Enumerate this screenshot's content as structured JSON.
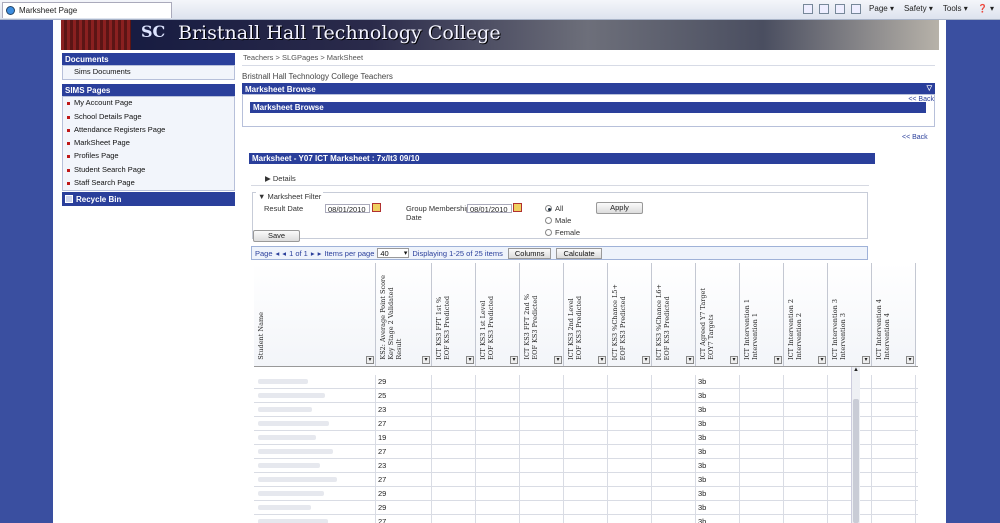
{
  "browser": {
    "tab_title": "Marksheet Page",
    "menus": [
      "Page ▾",
      "Safety ▾",
      "Tools ▾",
      "❓ ▾"
    ]
  },
  "banner": {
    "title": "Bristnall Hall Technology College",
    "logo_text": "SC"
  },
  "sidebar": {
    "documents_head": "Documents",
    "documents_items": [
      {
        "label": "Sims Documents"
      }
    ],
    "sims_head": "SIMS Pages",
    "sims_items": [
      {
        "label": "My Account Page"
      },
      {
        "label": "School Details Page"
      },
      {
        "label": "Attendance Registers Page"
      },
      {
        "label": "MarkSheet Page"
      },
      {
        "label": "Profiles Page"
      },
      {
        "label": "Student Search Page"
      },
      {
        "label": "Staff Search Page"
      }
    ],
    "recycle": "Recycle Bin"
  },
  "main": {
    "breadcrumb": "Teachers > SLGPages > MarkSheet",
    "subtitle": "Bristnall Hall Technology College Teachers",
    "browse_panel": "Marksheet Browse",
    "browse_title": "Marksheet Browse",
    "back_label": "<< Back",
    "marksheet_title": "Marksheet - Y07 ICT Marksheet : 7x/It3 09/10",
    "details_label": "▶ Details",
    "filter": {
      "legend": "▼ Marksheet Filter",
      "result_date_label": "Result Date",
      "result_date": "08/01/2010",
      "group_label": "Group Membership\nDate",
      "group_date": "08/01/2010",
      "radios": [
        {
          "label": "All",
          "checked": true
        },
        {
          "label": "Male",
          "checked": false
        },
        {
          "label": "Female",
          "checked": false
        }
      ],
      "apply": "Apply"
    },
    "save": "Save",
    "pager": {
      "page_label": "Page",
      "page_of": "1 of 1",
      "items_per_page_label": "Items per page",
      "items_per_page": "40",
      "displaying": "Displaying 1-25 of 25 items",
      "columns_btn": "Columns",
      "calculate_btn": "Calculate"
    }
  },
  "grid": {
    "columns": [
      {
        "label": "Student Name"
      },
      {
        "label": "KS2: Average Point Score\nKey Stage 2 Validated\nResult"
      },
      {
        "label": "ICT KS3 FFT 1st %\nEOF KS3 Predicted"
      },
      {
        "label": "ICT KS3 1st Level\nEOF KS3 Predicted"
      },
      {
        "label": "ICT KS3 FFT 2nd %\nEOF KS3 Predicted"
      },
      {
        "label": "ICT KS3 2nd Level\nEOF KS3 Predicted"
      },
      {
        "label": "ICT KS3 %Chance L5+\nEOF KS3 Predicted"
      },
      {
        "label": "ICT KS3 %Chance L6+\nEOF KS3 Predicted"
      },
      {
        "label": "ICT Agreed Y7 Target\nEOY7 Targets"
      },
      {
        "label": "ICT Intervention 1\nIntervention 1"
      },
      {
        "label": "ICT Intervention 2\nIntervention 2"
      },
      {
        "label": "ICT Intervention 3\nIntervention 3"
      },
      {
        "label": "ICT Intervention 4\nIntervention 4"
      }
    ],
    "rows": [
      {
        "ks2": "29",
        "target": "3b"
      },
      {
        "ks2": "25",
        "target": "3b"
      },
      {
        "ks2": "23",
        "target": "3b"
      },
      {
        "ks2": "27",
        "target": "3b"
      },
      {
        "ks2": "19",
        "target": "3b"
      },
      {
        "ks2": "27",
        "target": "3b"
      },
      {
        "ks2": "23",
        "target": "3b"
      },
      {
        "ks2": "27",
        "target": "3b"
      },
      {
        "ks2": "29",
        "target": "3b"
      },
      {
        "ks2": "29",
        "target": "3b"
      },
      {
        "ks2": "27",
        "target": "3b"
      }
    ]
  }
}
